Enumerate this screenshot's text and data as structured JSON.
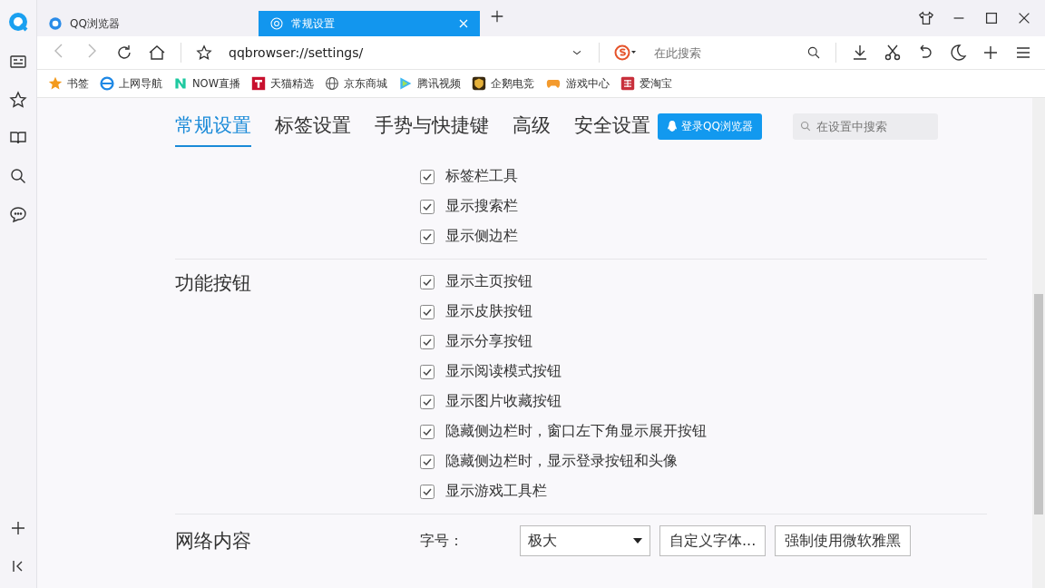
{
  "tabs": [
    {
      "label": "QQ浏览器",
      "selected": false
    },
    {
      "label": "常规设置",
      "selected": true
    }
  ],
  "address": {
    "value": "qqbrowser://settings/"
  },
  "search": {
    "placeholder": "在此搜索"
  },
  "bookmarks": [
    {
      "label": "书签"
    },
    {
      "label": "上网导航"
    },
    {
      "label": "NOW直播"
    },
    {
      "label": "天猫精选"
    },
    {
      "label": "京东商城"
    },
    {
      "label": "腾讯视频"
    },
    {
      "label": "企鹅电竞"
    },
    {
      "label": "游戏中心"
    },
    {
      "label": "爱淘宝"
    }
  ],
  "settings_nav": [
    {
      "label": "常规设置",
      "selected": true
    },
    {
      "label": "标签设置",
      "selected": false
    },
    {
      "label": "手势与快捷键",
      "selected": false
    },
    {
      "label": "高级",
      "selected": false
    },
    {
      "label": "安全设置",
      "selected": false
    }
  ],
  "login_button": "登录QQ浏览器",
  "settings_search": {
    "placeholder": "在设置中搜索"
  },
  "sections": [
    {
      "options": [
        {
          "label": "标签栏工具",
          "checked": true
        },
        {
          "label": "显示搜索栏",
          "checked": true
        },
        {
          "label": "显示侧边栏",
          "checked": true
        }
      ]
    },
    {
      "title": "功能按钮",
      "options": [
        {
          "label": "显示主页按钮",
          "checked": true
        },
        {
          "label": "显示皮肤按钮",
          "checked": true
        },
        {
          "label": "显示分享按钮",
          "checked": true
        },
        {
          "label": "显示阅读模式按钮",
          "checked": true
        },
        {
          "label": "显示图片收藏按钮",
          "checked": true
        },
        {
          "label": "隐藏侧边栏时，窗口左下角显示展开按钮",
          "checked": true
        },
        {
          "label": "隐藏侧边栏时，显示登录按钮和头像",
          "checked": true
        },
        {
          "label": "显示游戏工具栏",
          "checked": true
        }
      ]
    }
  ],
  "network": {
    "title": "网络内容",
    "font_size_label": "字号：",
    "font_size_value": "极大",
    "buttons": [
      "自定义字体...",
      "强制使用微软雅黑"
    ]
  }
}
